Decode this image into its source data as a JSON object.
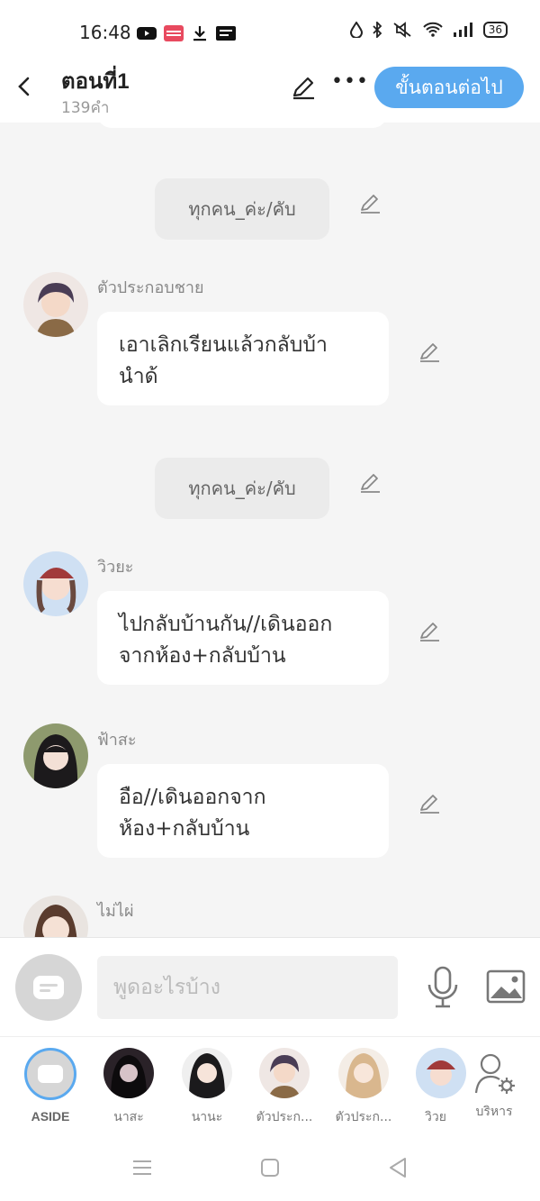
{
  "status_bar": {
    "time": "16:48",
    "battery": "36"
  },
  "header": {
    "title": "ตอนที่1",
    "subtitle": "139คำ",
    "next_label": "ขั้นตอนต่อไป"
  },
  "messages": [
    {
      "type": "narration",
      "text": "ทุกคน_ค่ะ/คับ"
    },
    {
      "type": "dialogue",
      "speaker": "ตัวประกอบชาย",
      "lines": [
        "เอาเลิกเรียนแล้วกลับบ้า",
        "นำด้"
      ]
    },
    {
      "type": "narration",
      "text": "ทุกคน_ค่ะ/คับ"
    },
    {
      "type": "dialogue",
      "speaker": "วิวยะ",
      "lines": [
        "ไปกลับบ้านกัน//เดินออก",
        "จากห้อง+กลับบ้าน"
      ]
    },
    {
      "type": "dialogue",
      "speaker": "ฟ้าสะ",
      "lines": [
        "อือ//เดินออกจาก",
        "ห้อง+กลับบ้าน"
      ]
    },
    {
      "type": "dialogue",
      "speaker": "ไม่ไผ่",
      "lines": []
    }
  ],
  "composer": {
    "placeholder": "พูดอะไรบ้าง"
  },
  "characters": [
    {
      "label": "ASIDE",
      "selected": true
    },
    {
      "label": "นาสะ"
    },
    {
      "label": "นานะ"
    },
    {
      "label": "ตัวประก..."
    },
    {
      "label": "ตัวประก..."
    },
    {
      "label": "วิวย"
    },
    {
      "label": "บริหาร"
    }
  ],
  "colors": {
    "accent": "#5aa9ef",
    "background": "#f5f5f5",
    "bubble": "#ffffff",
    "narration_bg": "#ebebeb"
  }
}
